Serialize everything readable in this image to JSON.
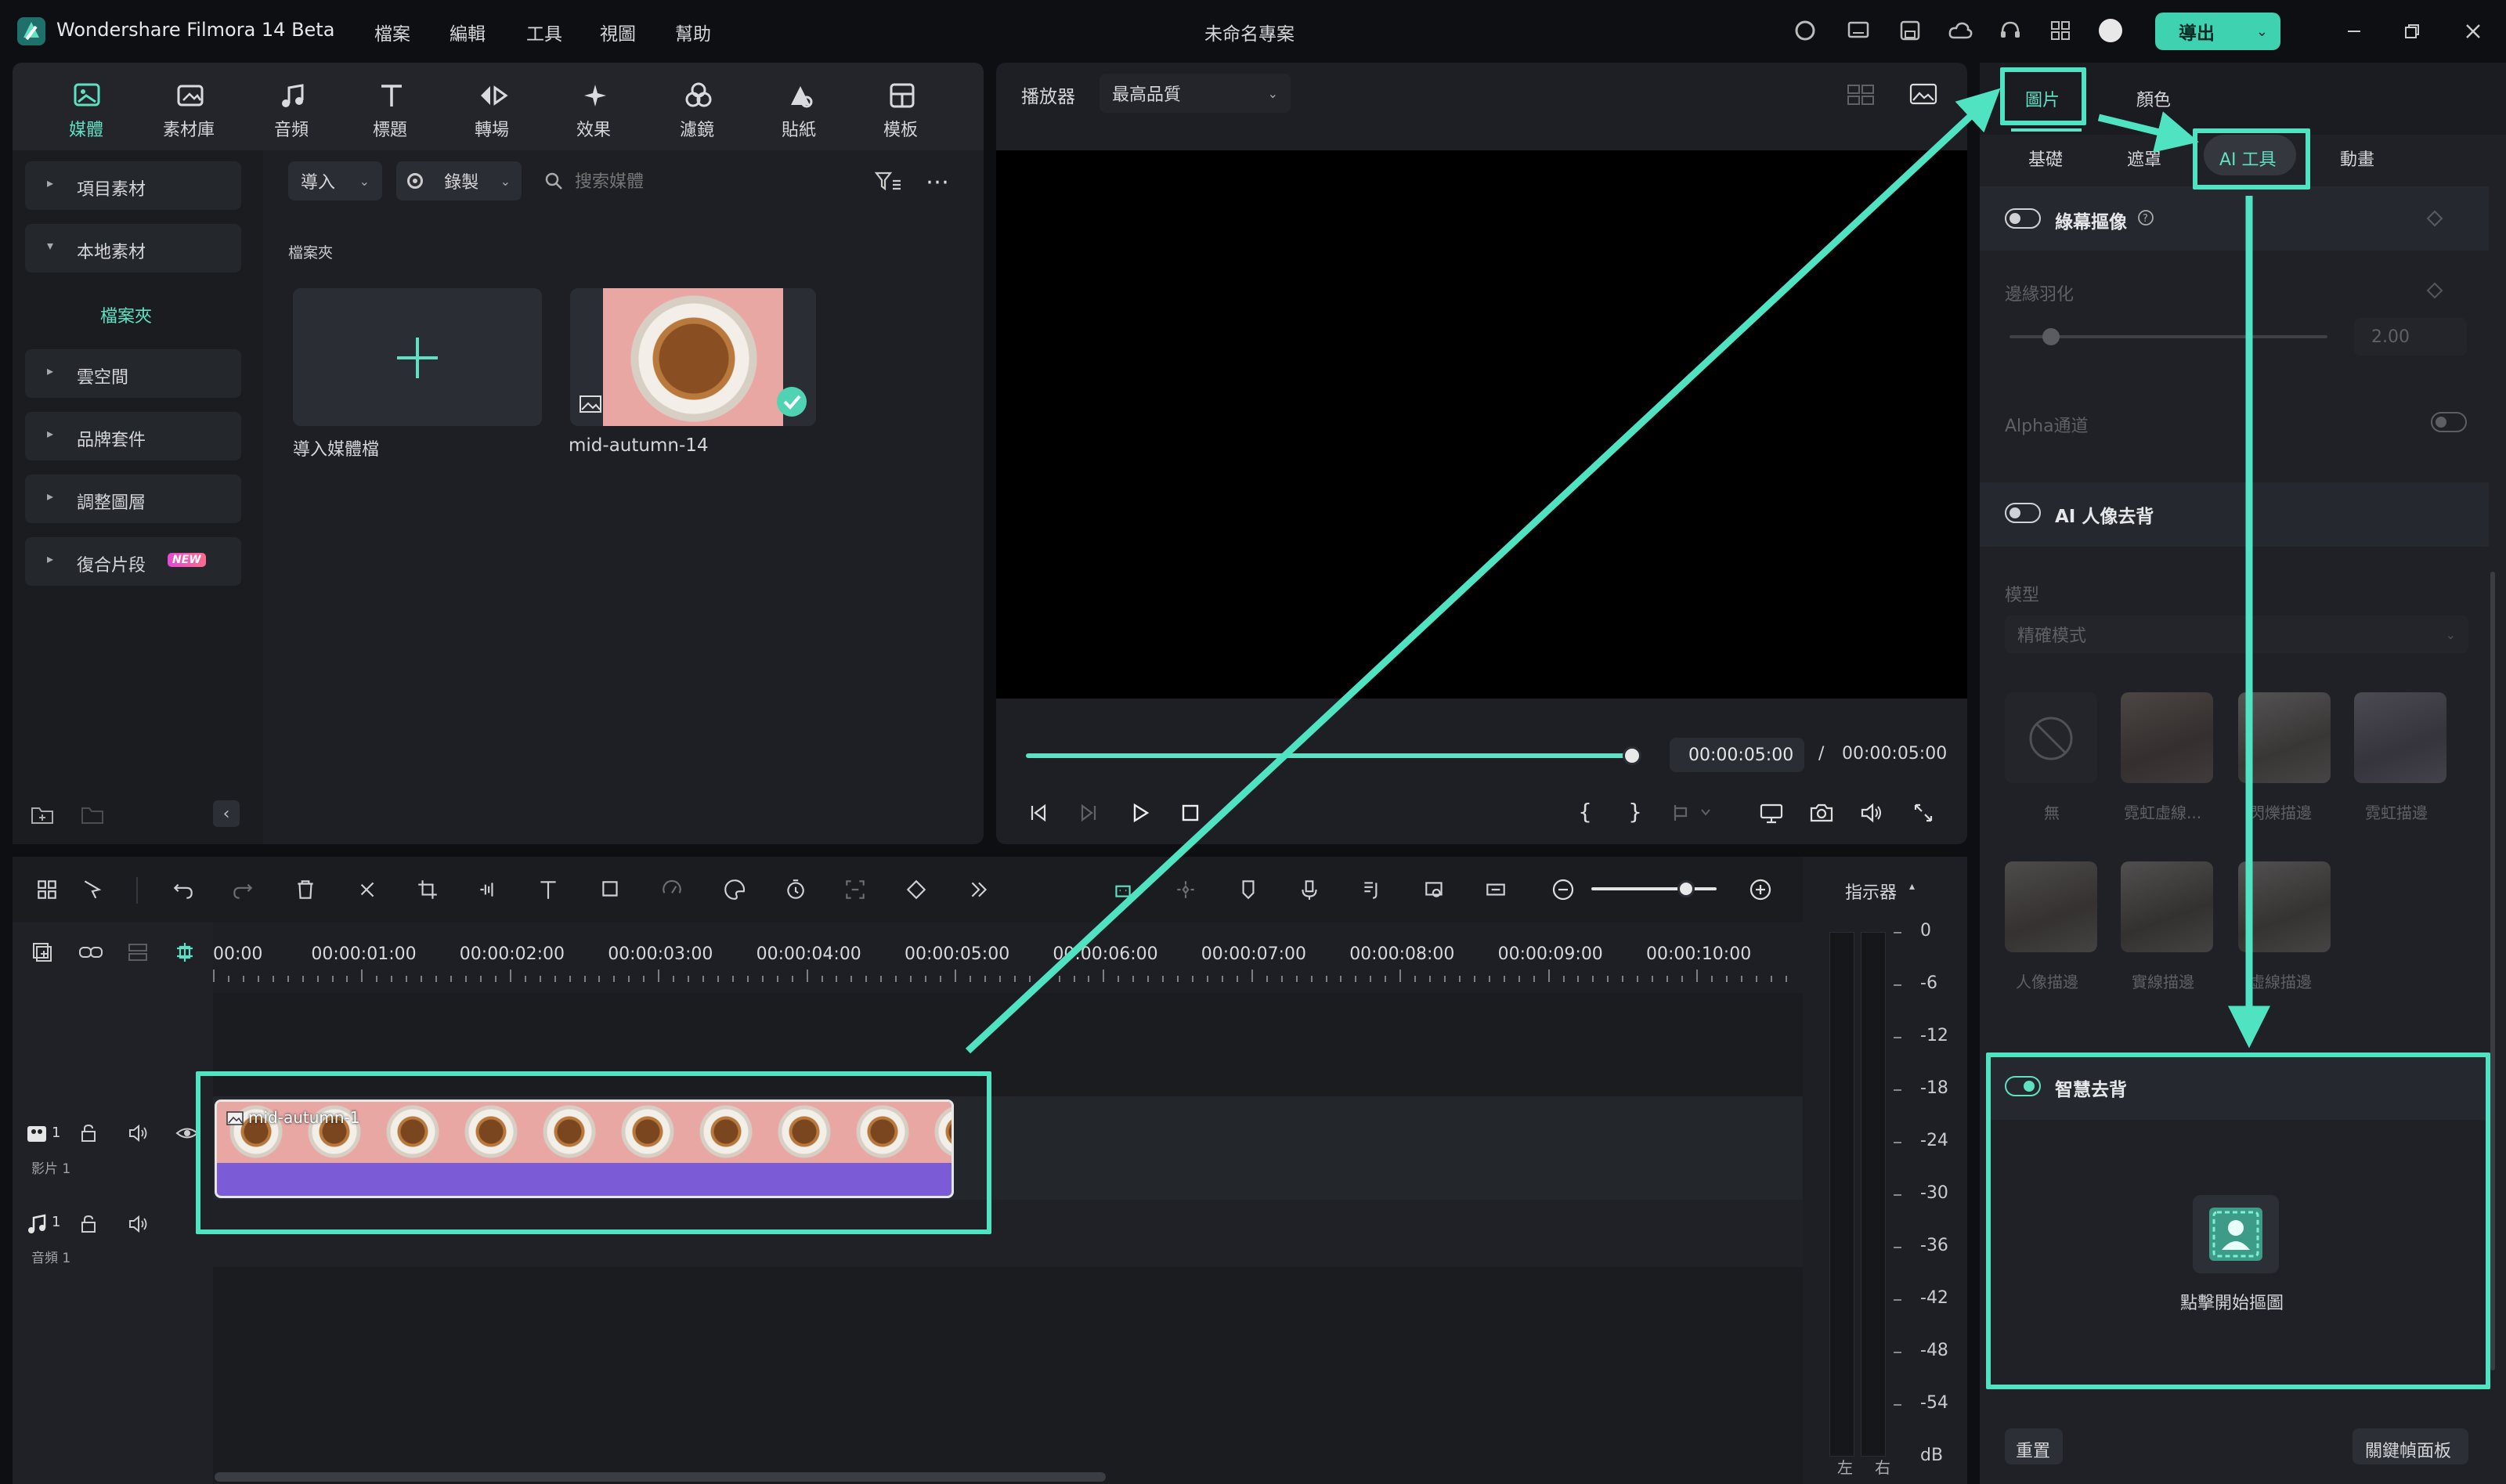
{
  "app": {
    "title": "Wondershare Filmora 14 Beta",
    "menu": [
      "檔案",
      "編輯",
      "工具",
      "視圖",
      "幫助"
    ],
    "project_title": "未命名專案",
    "export_label": "導出"
  },
  "media_tabs": [
    "媒體",
    "素材庫",
    "音頻",
    "標題",
    "轉場",
    "效果",
    "濾鏡",
    "貼紙",
    "模板"
  ],
  "sidebar": {
    "items": [
      {
        "label": "項目素材"
      },
      {
        "label": "本地素材"
      },
      {
        "label": "檔案夾"
      },
      {
        "label": "雲空間"
      },
      {
        "label": "品牌套件"
      },
      {
        "label": "調整圖層"
      },
      {
        "label": "復合片段",
        "badge": "NEW"
      }
    ]
  },
  "media_toolbar": {
    "import_label": "導入",
    "record_label": "錄製",
    "search_placeholder": "搜索媒體"
  },
  "media_area": {
    "folder_label": "檔案夾",
    "import_tile_label": "導入媒體檔",
    "clip_name": "mid-autumn-14"
  },
  "player": {
    "label": "播放器",
    "quality": "最高品質",
    "current_time": "00:00:05:00",
    "separator": "/",
    "total_time": "00:00:05:00",
    "progress_fraction": 1.0
  },
  "right_panel": {
    "top_tabs": [
      "圖片",
      "顏色"
    ],
    "sub_tabs": [
      "基礎",
      "遮罩",
      "AI 工具",
      "動畫"
    ],
    "chroma_key": {
      "label": "綠幕摳像",
      "enabled": false
    },
    "edge_feather": {
      "label": "邊緣羽化",
      "value": "2.00"
    },
    "alpha": {
      "label": "Alpha通道"
    },
    "ai_portrait": {
      "label": "AI 人像去背",
      "enabled": false
    },
    "model": {
      "label": "模型",
      "value": "精確模式"
    },
    "presets": [
      {
        "label": "無"
      },
      {
        "label": "霓虹虛線..."
      },
      {
        "label": "閃爍描邊"
      },
      {
        "label": "霓虹描邊"
      },
      {
        "label": "人像描邊"
      },
      {
        "label": "實線描邊"
      },
      {
        "label": "虛線描邊"
      }
    ],
    "smart_cutout": {
      "label": "智慧去背",
      "enabled": true,
      "start_label": "點擊開始摳圖"
    },
    "reset_label": "重置",
    "keyframe_label": "關鍵幀面板"
  },
  "timeline": {
    "ruler": [
      "00:00",
      "00:00:01:00",
      "00:00:02:00",
      "00:00:03:00",
      "00:00:04:00",
      "00:00:05:00",
      "00:00:06:00",
      "00:00:07:00",
      "00:00:08:00",
      "00:00:09:00",
      "00:00:10:00"
    ],
    "video_track": {
      "index": "1",
      "label": "影片 1"
    },
    "audio_track": {
      "index": "1",
      "label": "音頻 1"
    },
    "clip_label": "mid-autumn-1",
    "meter_label": "指示器",
    "meter_scale": [
      "0",
      "-6",
      "-12",
      "-18",
      "-24",
      "-30",
      "-36",
      "-42",
      "-48",
      "-54",
      "dB"
    ],
    "meter_channels": [
      "左",
      "右"
    ]
  },
  "colors": {
    "accent": "#5fe0c2",
    "highlight_box": "#4fe3c1",
    "clip_purple": "#7b5cd6"
  }
}
